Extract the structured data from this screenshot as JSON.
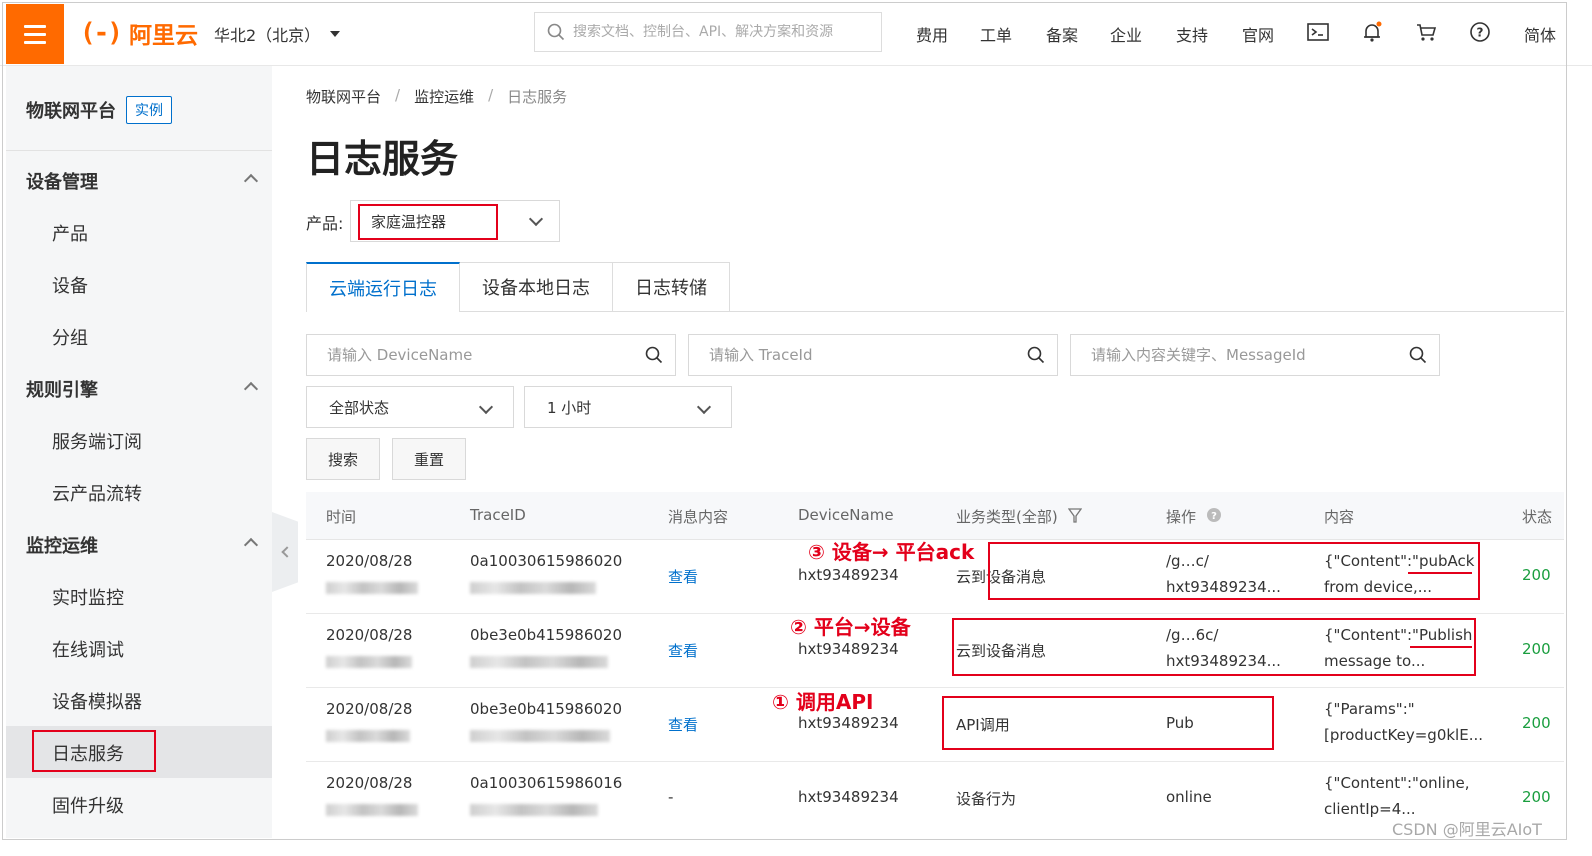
{
  "topbar": {
    "logo_mark": "(-)",
    "logo_text": "阿里云",
    "region": "华北2（北京）",
    "search_placeholder": "搜索文档、控制台、API、解决方案和资源",
    "nav": [
      "费用",
      "工单",
      "备案",
      "企业",
      "支持",
      "官网"
    ],
    "lang": "简体",
    "icons": [
      "terminal-icon",
      "bell-icon",
      "cart-icon",
      "help-icon"
    ]
  },
  "sidebar": {
    "title": "物联网平台",
    "badge": "实例",
    "groups": [
      {
        "label": "设备管理",
        "items": [
          "产品",
          "设备",
          "分组"
        ]
      },
      {
        "label": "规则引擎",
        "items": [
          "服务端订阅",
          "云产品流转"
        ]
      },
      {
        "label": "监控运维",
        "items": [
          "实时监控",
          "在线调试",
          "设备模拟器",
          "日志服务",
          "固件升级"
        ]
      }
    ],
    "active": "日志服务"
  },
  "breadcrumb": [
    "物联网平台",
    "监控运维",
    "日志服务"
  ],
  "breadcrumb_sep": "/",
  "page_title": "日志服务",
  "product": {
    "label": "产品:",
    "value": "家庭温控器"
  },
  "tabs": [
    "云端运行日志",
    "设备本地日志",
    "日志转储"
  ],
  "filters": {
    "device_placeholder": "请输入 DeviceName",
    "trace_placeholder": "请输入 TraceId",
    "content_placeholder": "请输入内容关键字、MessageId",
    "status_value": "全部状态",
    "time_value": "1 小时",
    "search_btn": "搜索",
    "reset_btn": "重置"
  },
  "table": {
    "columns": [
      "时间",
      "TraceID",
      "消息内容",
      "DeviceName",
      "业务类型(全部)",
      "操作",
      "内容",
      "状态"
    ],
    "rows": [
      {
        "date": "2020/08/28",
        "trace": "0a10030615986020",
        "msg": "查看",
        "device": "hxt93489234",
        "type": "云到设备消息",
        "op1": "/g…c/",
        "op2": "hxt93489234...",
        "content1": "{\"Content\":\"pubAck",
        "content2": "from device,...",
        "status": "200"
      },
      {
        "date": "2020/08/28",
        "trace": "0be3e0b415986020",
        "msg": "查看",
        "device": "hxt93489234",
        "type": "云到设备消息",
        "op1": "/g…6c/",
        "op2": "hxt93489234...",
        "content1": "{\"Content\":\"Publish",
        "content2": "message to...",
        "status": "200"
      },
      {
        "date": "2020/08/28",
        "trace": "0be3e0b415986020",
        "msg": "查看",
        "device": "hxt93489234",
        "type": "API调用",
        "op1": "Pub",
        "op2": "",
        "content1": "{\"Params\":\"",
        "content2": "[productKey=g0klE...",
        "status": "200"
      },
      {
        "date": "2020/08/28",
        "trace": "0a10030615986016",
        "msg": "-",
        "device": "hxt93489234",
        "type": "设备行为",
        "op1": "online",
        "op2": "",
        "content1": "{\"Content\":\"online,",
        "content2": "clientIp=4...",
        "status": "200"
      }
    ]
  },
  "annotations": {
    "a3": "③ 设备→ 平台ack",
    "a2": "② 平台→设备",
    "a1": "① 调用API"
  },
  "watermark": "CSDN @阿里云AIoT",
  "colors": {
    "accent": "#ff6a00",
    "link": "#0070cc",
    "annotation": "#e3001b",
    "success": "#1a9e3f"
  }
}
